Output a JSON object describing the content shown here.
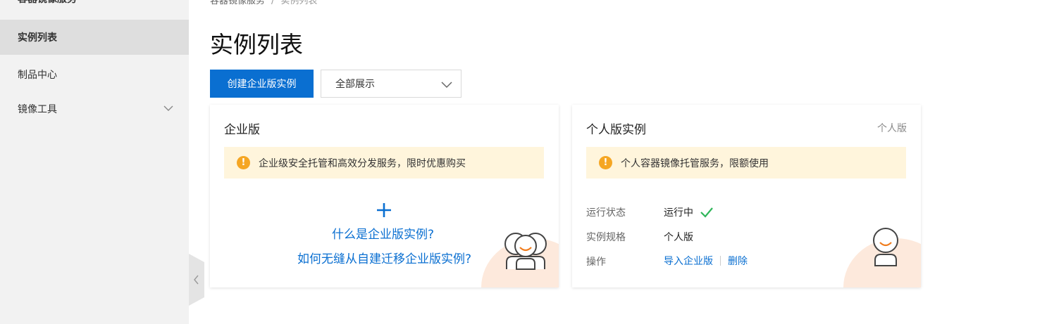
{
  "sidebar": {
    "product_title": "容器镜像服务",
    "items": [
      {
        "label": "实例列表",
        "active": true
      },
      {
        "label": "制品中心",
        "active": false
      },
      {
        "label": "镜像工具",
        "active": false,
        "expandable": true
      }
    ]
  },
  "breadcrumb": {
    "root": "容器镜像服务",
    "separator": "/",
    "current": "实例列表"
  },
  "page": {
    "title": "实例列表",
    "create_button": "创建企业版实例",
    "filter_value": "全部展示"
  },
  "enterprise_card": {
    "title": "企业版",
    "notice": "企业级安全托管和高效分发服务，限时优惠购买",
    "link_what": "什么是企业版实例?",
    "link_migrate": "如何无缝从自建迁移企业版实例?"
  },
  "personal_card": {
    "title": "个人版实例",
    "tag": "个人版",
    "notice": "个人容器镜像托管服务，限额使用",
    "status_label": "运行状态",
    "status_value": "运行中",
    "spec_label": "实例规格",
    "spec_value": "个人版",
    "ops_label": "操作",
    "op_import": "导入企业版",
    "op_delete": "删除"
  },
  "colors": {
    "accent": "#0a6fd1",
    "warning": "#f5a623",
    "notice_bg": "#fff5dc",
    "success": "#2fb65a",
    "deco": "#fde9dc"
  },
  "icons": [
    "chevron-down-icon",
    "collapse-left-icon",
    "warning-icon",
    "plus-icon",
    "check-icon",
    "team-avatar-icon",
    "user-avatar-icon"
  ]
}
